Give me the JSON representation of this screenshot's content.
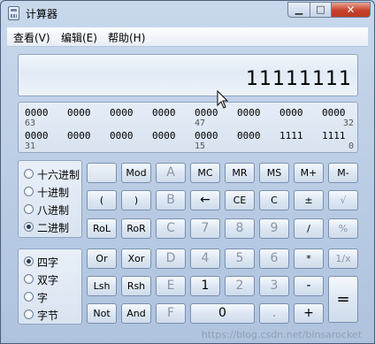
{
  "window": {
    "title": "计算器"
  },
  "menu": [
    "查看(V)",
    "编辑(E)",
    "帮助(H)"
  ],
  "display": {
    "value": "11111111"
  },
  "bits": {
    "groups": [
      "0000",
      "0000",
      "0000",
      "0000",
      "0000",
      "0000",
      "0000",
      "0000",
      "0000",
      "0000",
      "0000",
      "0000",
      "0000",
      "0000",
      "1111",
      "1111"
    ],
    "positions": [
      "63",
      "47",
      "32",
      "31",
      "15",
      "0"
    ]
  },
  "radix": {
    "options": [
      "十六进制",
      "十进制",
      "八进制",
      "二进制"
    ],
    "selected": "二进制"
  },
  "word_size": {
    "options": [
      "四字",
      "双字",
      "字",
      "字节"
    ],
    "selected": "四字"
  },
  "buttons": [
    [
      "",
      "Mod",
      "A",
      "MC",
      "MR",
      "MS",
      "M+",
      "M-"
    ],
    [
      "(",
      ")",
      "B",
      "←",
      "CE",
      "C",
      "±",
      "√"
    ],
    [
      "RoL",
      "RoR",
      "C",
      "7",
      "8",
      "9",
      "/",
      "%"
    ],
    [
      "Or",
      "Xor",
      "D",
      "4",
      "5",
      "6",
      "*",
      "1/x"
    ],
    [
      "Lsh",
      "Rsh",
      "E",
      "1",
      "2",
      "3",
      "-",
      "="
    ],
    [
      "Not",
      "And",
      "F",
      "0",
      ".",
      "+"
    ]
  ],
  "disabled": [
    "A",
    "B",
    "C",
    "D",
    "E",
    "F",
    "7",
    "8",
    "9",
    "4",
    "5",
    "6",
    "3",
    "2",
    ".",
    "√",
    "%",
    "1/x"
  ],
  "watermark": "https://blog.csdn.net/binsarocket"
}
